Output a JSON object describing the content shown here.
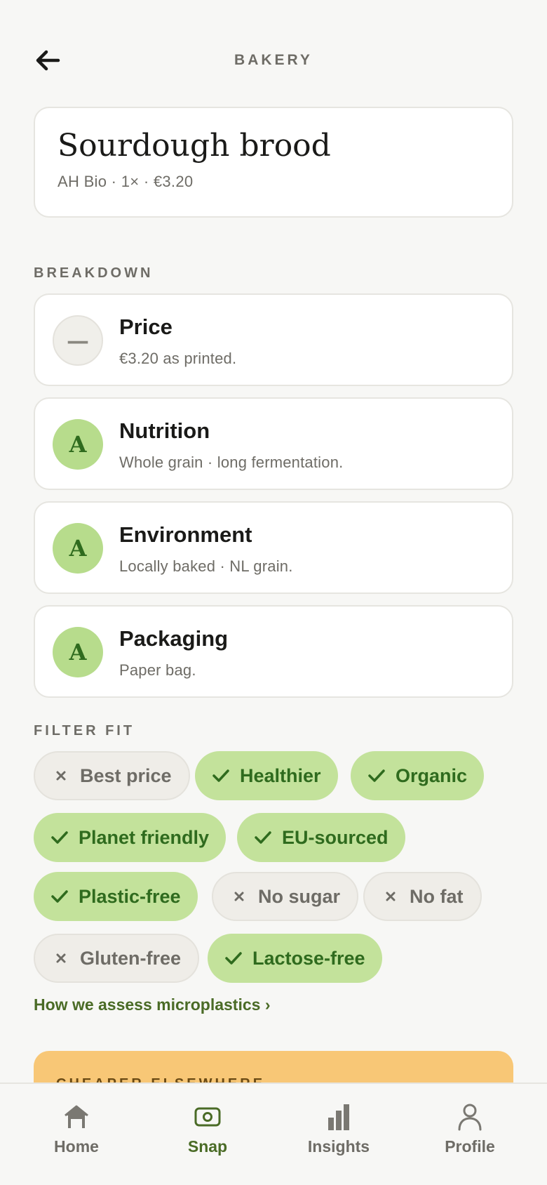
{
  "header": {
    "title": "BAKERY",
    "back_icon": "arrow-left-icon"
  },
  "product": {
    "name": "Sourdough brood",
    "meta": "AH Bio · 1× · €3.20"
  },
  "breakdown": {
    "label": "BREAKDOWN",
    "items": [
      {
        "title": "Price",
        "desc": "€3.20 as printed.",
        "badge": "—",
        "status": "neutral"
      },
      {
        "title": "Nutrition",
        "desc": "Whole grain · long fermentation.",
        "badge": "A",
        "status": "good"
      },
      {
        "title": "Environment",
        "desc": "Locally baked · NL grain.",
        "badge": "A",
        "status": "good"
      },
      {
        "title": "Packaging",
        "desc": "Paper bag.",
        "badge": "A",
        "status": "good"
      }
    ]
  },
  "filter_fit": {
    "label": "FILTER FIT",
    "chips": [
      {
        "label": "Best price",
        "match": false
      },
      {
        "label": "Healthier",
        "match": true
      },
      {
        "label": "Organic",
        "match": true
      },
      {
        "label": "Planet friendly",
        "match": true
      },
      {
        "label": "EU-sourced",
        "match": true
      },
      {
        "label": "Plastic-free",
        "match": true
      },
      {
        "label": "No sugar",
        "match": false
      },
      {
        "label": "No fat",
        "match": false
      },
      {
        "label": "Gluten-free",
        "match": false
      },
      {
        "label": "Lactose-free",
        "match": true
      }
    ],
    "link": "How we assess microplastics ›"
  },
  "promo": {
    "label": "CHEAPER ELSEWHERE"
  },
  "tabbar": {
    "tabs": [
      {
        "label": "Home",
        "icon": "home-icon"
      },
      {
        "label": "Snap",
        "icon": "camera-icon",
        "active": true
      },
      {
        "label": "Insights",
        "icon": "bar-chart-icon"
      },
      {
        "label": "Profile",
        "icon": "person-icon"
      }
    ]
  },
  "colors": {
    "accent": "#4a6b26",
    "good_badge": "#b7dc8c",
    "chip_on": "#c3e29b",
    "promo": "#f8c776",
    "background": "#f7f7f5"
  }
}
